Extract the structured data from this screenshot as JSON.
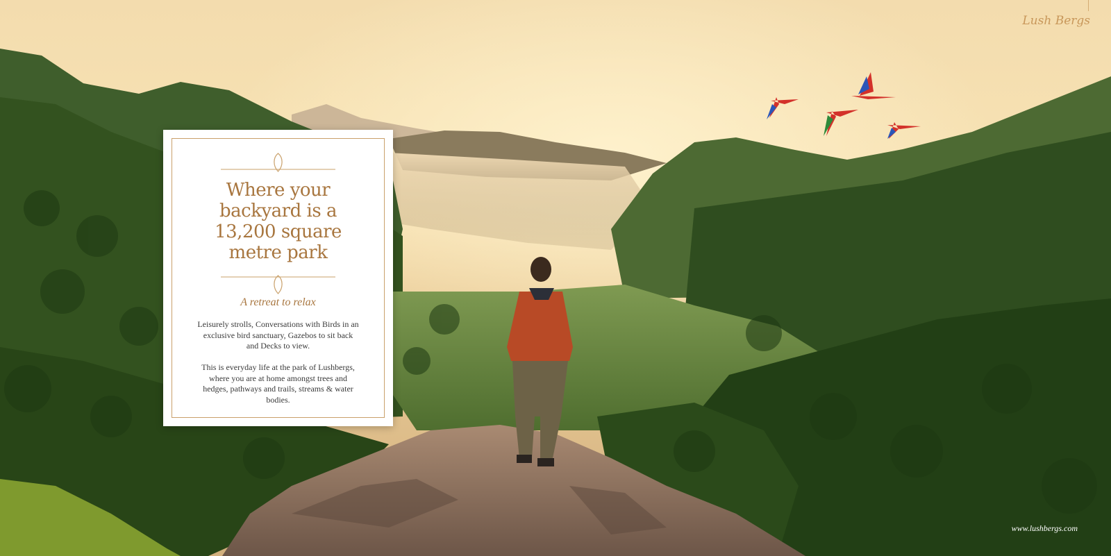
{
  "brand": {
    "logo_text": "Lush Bergs",
    "website": "www.lushbergs.com"
  },
  "card": {
    "headline_lines": [
      "Where your",
      "backyard is a",
      "13,200 square",
      "metre park"
    ],
    "subtitle": "A retreat to relax",
    "paragraph1_lines": [
      "Leisurely strolls, Conversations with Birds in an",
      "exclusive bird sanctuary, Gazebos to sit back",
      "and Decks to view."
    ],
    "paragraph2_lines": [
      "This is everyday life at the park of Lushbergs,",
      "where you are at home amongst trees and",
      "hedges, pathways and trails, streams & water",
      "bodies."
    ]
  },
  "colors": {
    "accent_gold": "#a8763f",
    "frame_gold": "#c9a06a",
    "card_bg": "#ffffff"
  }
}
